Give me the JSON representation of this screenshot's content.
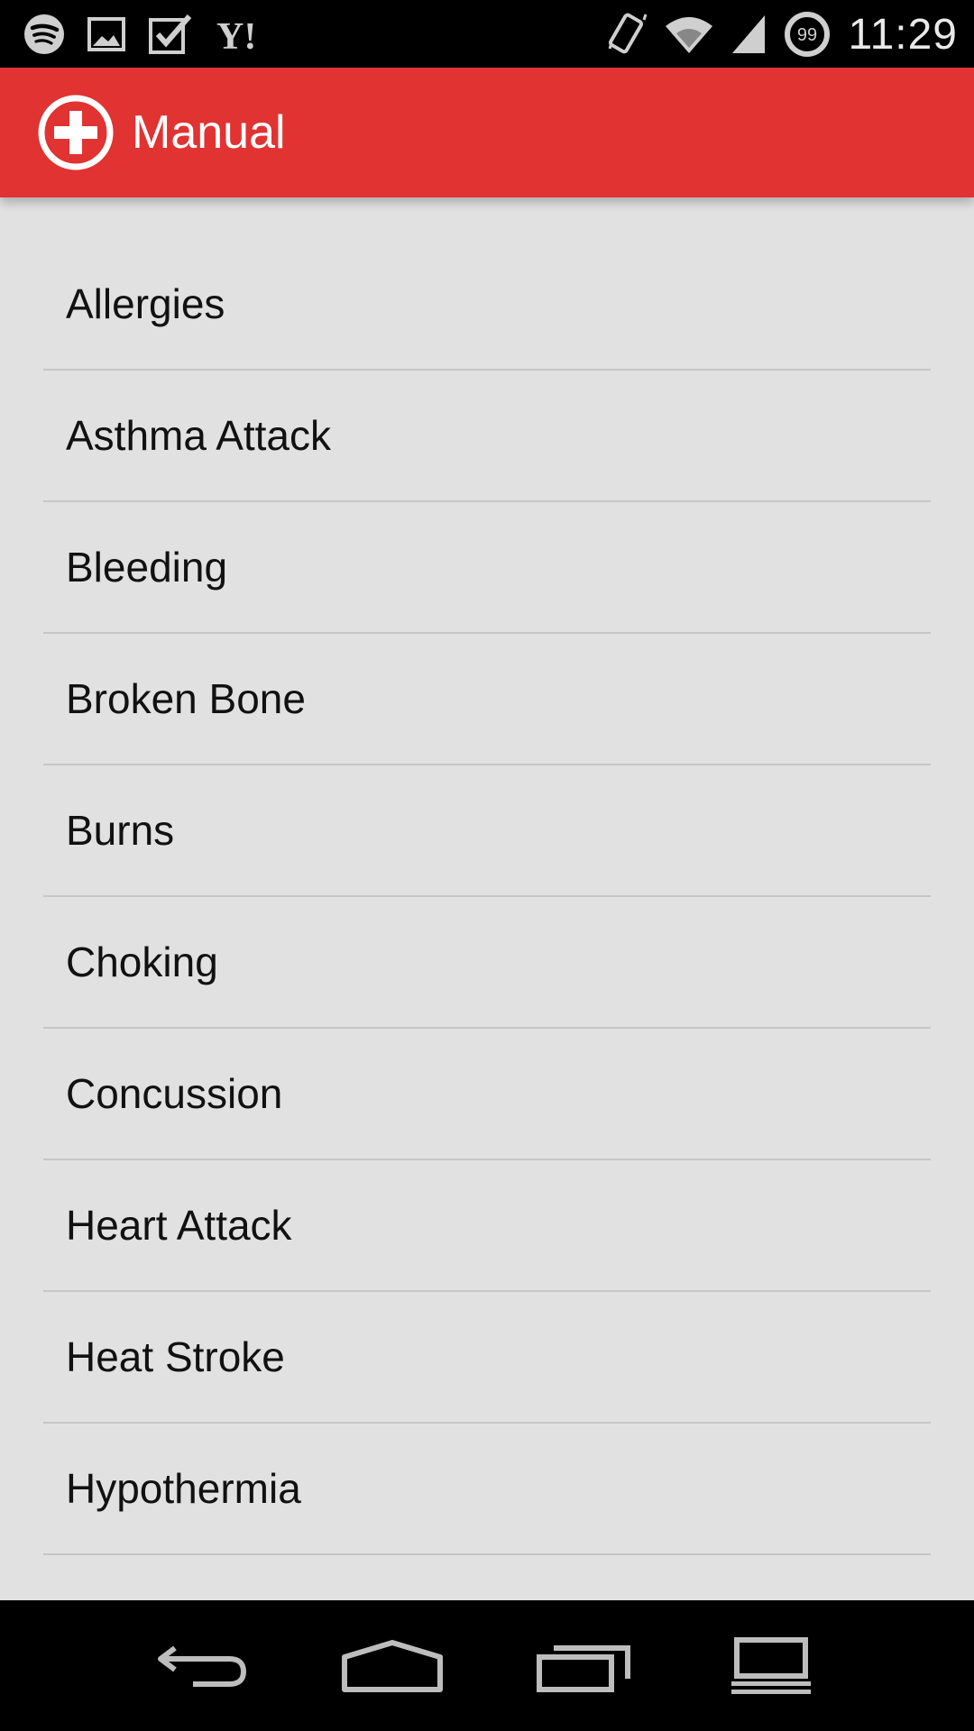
{
  "status_bar": {
    "left_icons": [
      "spotify-icon",
      "gallery-icon",
      "checkbox-icon",
      "yahoo-icon"
    ],
    "right_icons": [
      "vibrate-icon",
      "wifi-icon",
      "signal-icon"
    ],
    "battery_badge": "99",
    "time": "11:29"
  },
  "app_bar": {
    "icon": "first-aid-plus-icon",
    "title": "Manual",
    "accent_color": "#e03332"
  },
  "list": {
    "items": [
      {
        "label": "Allergies"
      },
      {
        "label": "Asthma Attack"
      },
      {
        "label": "Bleeding"
      },
      {
        "label": "Broken Bone"
      },
      {
        "label": "Burns"
      },
      {
        "label": "Choking"
      },
      {
        "label": "Concussion"
      },
      {
        "label": "Heart Attack"
      },
      {
        "label": "Heat Stroke"
      },
      {
        "label": "Hypothermia"
      }
    ]
  },
  "nav_bar": {
    "buttons": [
      "back-icon",
      "home-icon",
      "recents-icon",
      "menu-icon"
    ]
  }
}
